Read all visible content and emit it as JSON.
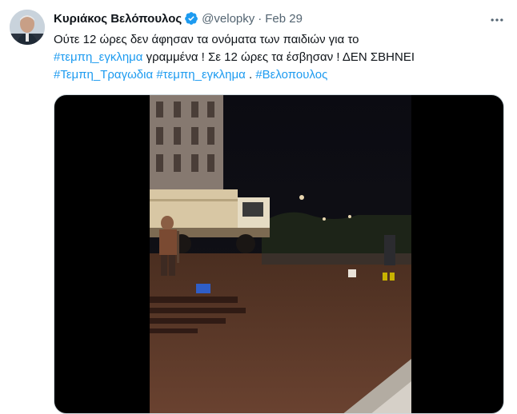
{
  "author": {
    "name": "Κυριάκος Βελόπουλος",
    "handle": "@velopky",
    "separator": "·",
    "date": "Feb 29",
    "avatar_icon": "avatar-photo",
    "verified_icon": "verified-badge-icon"
  },
  "tweet": {
    "line1": "Ούτε 12 ώρες δεν άφησαν τα ονόματα των παιδιών για το",
    "hashtag1": "#τεμπη_εγκλημα",
    "line2_rest": " γραμμένα ! Σε 12 ώρες τα έσβησαν ! ΔΕΝ ΣΒΗΝΕΙ",
    "hashtag2": "#Τεμπη_Τραγωδια",
    "hashtag3": "#τεμπη_εγκλημα",
    "between": " . ",
    "hashtag4": "#Βελοπουλος"
  },
  "media": {
    "type": "video",
    "scene_icon": "night-street-video-frame"
  },
  "colors": {
    "link": "#1d9bf0",
    "text": "#0f1419",
    "muted": "#536471",
    "verified": "#1d9bf0"
  }
}
